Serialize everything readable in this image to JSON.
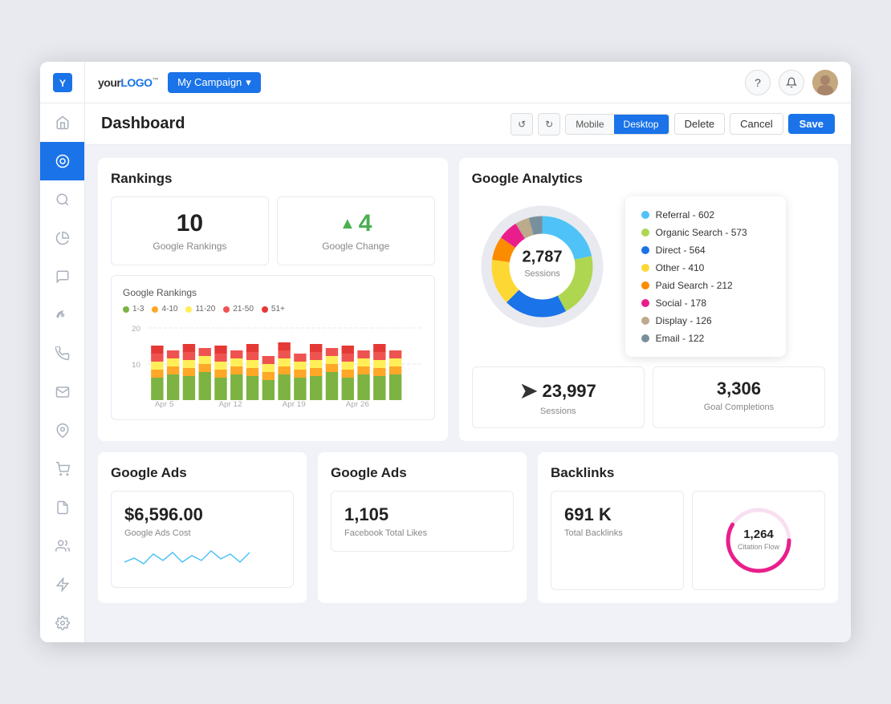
{
  "topnav": {
    "logo": "your",
    "logo_highlight": "LOGO",
    "campaign_label": "My Campaign",
    "help_icon": "?",
    "notification_icon": "🔔"
  },
  "toolbar": {
    "title": "Dashboard",
    "mobile_label": "Mobile",
    "desktop_label": "Desktop",
    "delete_label": "Delete",
    "cancel_label": "Cancel",
    "save_label": "Save"
  },
  "rankings": {
    "title": "Rankings",
    "google_rankings_value": "10",
    "google_rankings_label": "Google Rankings",
    "google_change_value": "4",
    "google_change_label": "Google Change",
    "chart_title": "Google Rankings",
    "legend": [
      {
        "label": "1-3",
        "color": "#7cb342"
      },
      {
        "label": "4-10",
        "color": "#ffa726"
      },
      {
        "label": "11-20",
        "color": "#ffee58"
      },
      {
        "label": "21-50",
        "color": "#ef5350"
      },
      {
        "label": "51+",
        "color": "#e53935"
      }
    ],
    "x_labels": [
      "Apr 5",
      "Apr 12",
      "Apr 19",
      "Apr 26"
    ],
    "y_labels": [
      "20",
      "10"
    ]
  },
  "google_analytics": {
    "title": "Google Analytics",
    "donut_value": "2,787",
    "donut_label": "Sessions",
    "legend": [
      {
        "label": "Referral - 602",
        "color": "#4fc3f7",
        "value": 602
      },
      {
        "label": "Organic Search - 573",
        "color": "#aed651",
        "value": 573
      },
      {
        "label": "Direct - 564",
        "color": "#1a73e8",
        "value": 564
      },
      {
        "label": "Other - 410",
        "color": "#fdd835",
        "value": 410
      },
      {
        "label": "Paid Search - 212",
        "color": "#fb8c00",
        "value": 212
      },
      {
        "label": "Social - 178",
        "color": "#e91e8c",
        "value": 178
      },
      {
        "label": "Display - 126",
        "color": "#bcaa8c",
        "value": 126
      },
      {
        "label": "Email - 122",
        "color": "#78909c",
        "value": 122
      }
    ],
    "sessions_value": "23,997",
    "sessions_label": "Sessions",
    "goal_completions_value": "3,306",
    "goal_completions_label": "Goal Completions"
  },
  "google_ads": {
    "title1": "Google Ads",
    "title2": "Google Ads",
    "cost_value": "$6,596.00",
    "cost_label": "Google Ads Cost",
    "likes_value": "1,105",
    "likes_label": "Facebook Total Likes"
  },
  "backlinks": {
    "title": "Backlinks",
    "total_value": "691 K",
    "total_label": "Total Backlinks",
    "citation_value": "1,264",
    "citation_label": "Citation Flow"
  },
  "sidebar": {
    "items": [
      {
        "icon": "⌂",
        "name": "home"
      },
      {
        "icon": "◉",
        "name": "analytics",
        "active": true
      },
      {
        "icon": "🔍",
        "name": "search"
      },
      {
        "icon": "📊",
        "name": "reports"
      },
      {
        "icon": "💬",
        "name": "messages"
      },
      {
        "icon": "👁",
        "name": "monitor"
      },
      {
        "icon": "📞",
        "name": "phone"
      },
      {
        "icon": "✉",
        "name": "email"
      },
      {
        "icon": "📍",
        "name": "location"
      },
      {
        "icon": "🛒",
        "name": "shopping"
      },
      {
        "icon": "📄",
        "name": "documents"
      },
      {
        "icon": "👥",
        "name": "users"
      },
      {
        "icon": "⚡",
        "name": "integrations"
      },
      {
        "icon": "⚙",
        "name": "settings"
      }
    ]
  }
}
